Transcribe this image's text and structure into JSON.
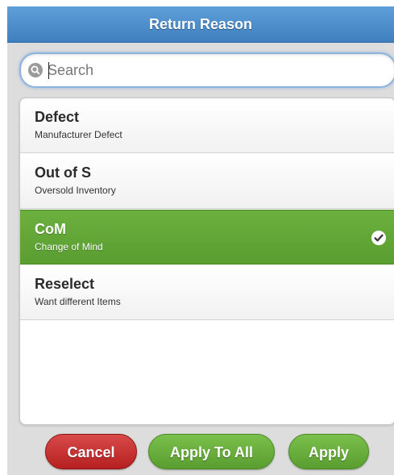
{
  "header": {
    "title": "Return Reason"
  },
  "search": {
    "placeholder": "Search",
    "value": ""
  },
  "reasons": [
    {
      "code": "Defect",
      "description": "Manufacturer Defect",
      "selected": false
    },
    {
      "code": "Out of S",
      "description": "Oversold Inventory",
      "selected": false
    },
    {
      "code": "CoM",
      "description": "Change of Mind",
      "selected": true
    },
    {
      "code": "Reselect",
      "description": "Want different Items",
      "selected": false
    }
  ],
  "buttons": {
    "cancel_label": "Cancel",
    "apply_all_label": "Apply To All",
    "apply_label": "Apply"
  },
  "colors": {
    "header": "#4a8ccf",
    "selected_row": "#62a838",
    "cancel": "#c53030",
    "apply": "#68ae3d"
  },
  "icons": {
    "search": "search-icon",
    "selected": "check-circle-icon"
  }
}
